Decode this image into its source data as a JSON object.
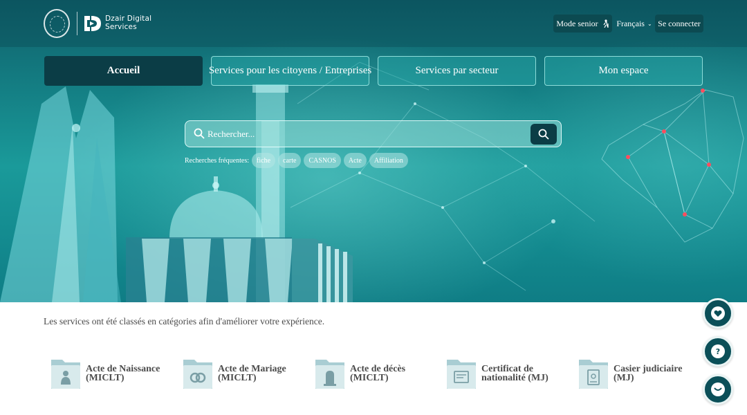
{
  "brand": {
    "name_line1": "Dzair Digital",
    "name_line2": "Services"
  },
  "topbar": {
    "senior_label": "Mode senior",
    "language_label": "Français",
    "connect_label": "Se connecter"
  },
  "nav": {
    "tabs": [
      {
        "label": "Accueil",
        "active": true
      },
      {
        "label": "Services pour les citoyens / Entreprises",
        "active": false
      },
      {
        "label": "Services par secteur",
        "active": false
      },
      {
        "label": "Mon espace",
        "active": false
      }
    ]
  },
  "search": {
    "placeholder": "Rechercher...",
    "frequent_label": "Recherches fréquentes:",
    "chips": [
      "fiche",
      "carte",
      "CASNOS",
      "Acte",
      "Affiliation"
    ]
  },
  "content": {
    "intro": "Les services ont été classés en catégories afin d'améliorer votre expérience.",
    "categories": [
      {
        "line1": "Acte de Naissance",
        "line2": "(MICLT)",
        "icon": "baby-icon"
      },
      {
        "line1": "Acte de Mariage",
        "line2": "(MICLT)",
        "icon": "rings-icon"
      },
      {
        "line1": "Acte de décès",
        "line2": "(MICLT)",
        "icon": "tombstone-icon"
      },
      {
        "line1": "Certificat de",
        "line2": "nationalité (MJ)",
        "icon": "certificate-icon"
      },
      {
        "line1": "Casier judiciaire",
        "line2": "(MJ)",
        "icon": "document-icon"
      }
    ]
  },
  "floating": [
    "favorites-icon",
    "help-icon",
    "chat-icon"
  ],
  "colors": {
    "dark_teal": "#0b3d46",
    "hero_teal": "#1a9a9a",
    "folder": "#a9cdd3",
    "text_gray": "#4b4b4b"
  }
}
